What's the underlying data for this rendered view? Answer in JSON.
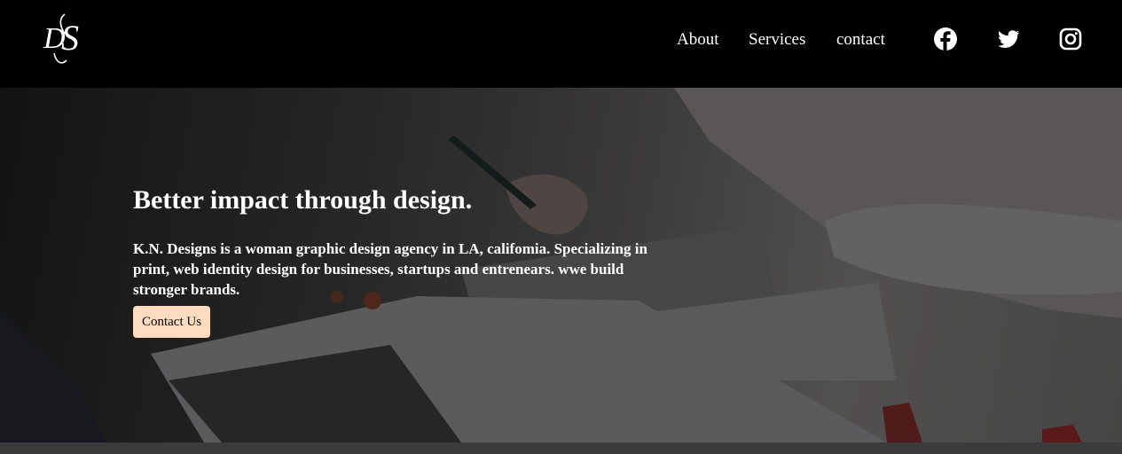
{
  "nav": {
    "links": [
      "About",
      "Services",
      "contact"
    ],
    "social": [
      "facebook-icon",
      "twitter-icon",
      "instagram-icon"
    ]
  },
  "hero": {
    "title": "Better impact through design.",
    "description": "K.N. Designs is a woman graphic design agency in LA, califomia. Specializing in print, web identity design for businesses, startups and entrenears. wwe build stronger brands.",
    "cta_label": "Contact Us"
  },
  "colors": {
    "navbar_bg": "#000000",
    "cta_bg": "#ffdcc0",
    "text": "#ffffff"
  }
}
